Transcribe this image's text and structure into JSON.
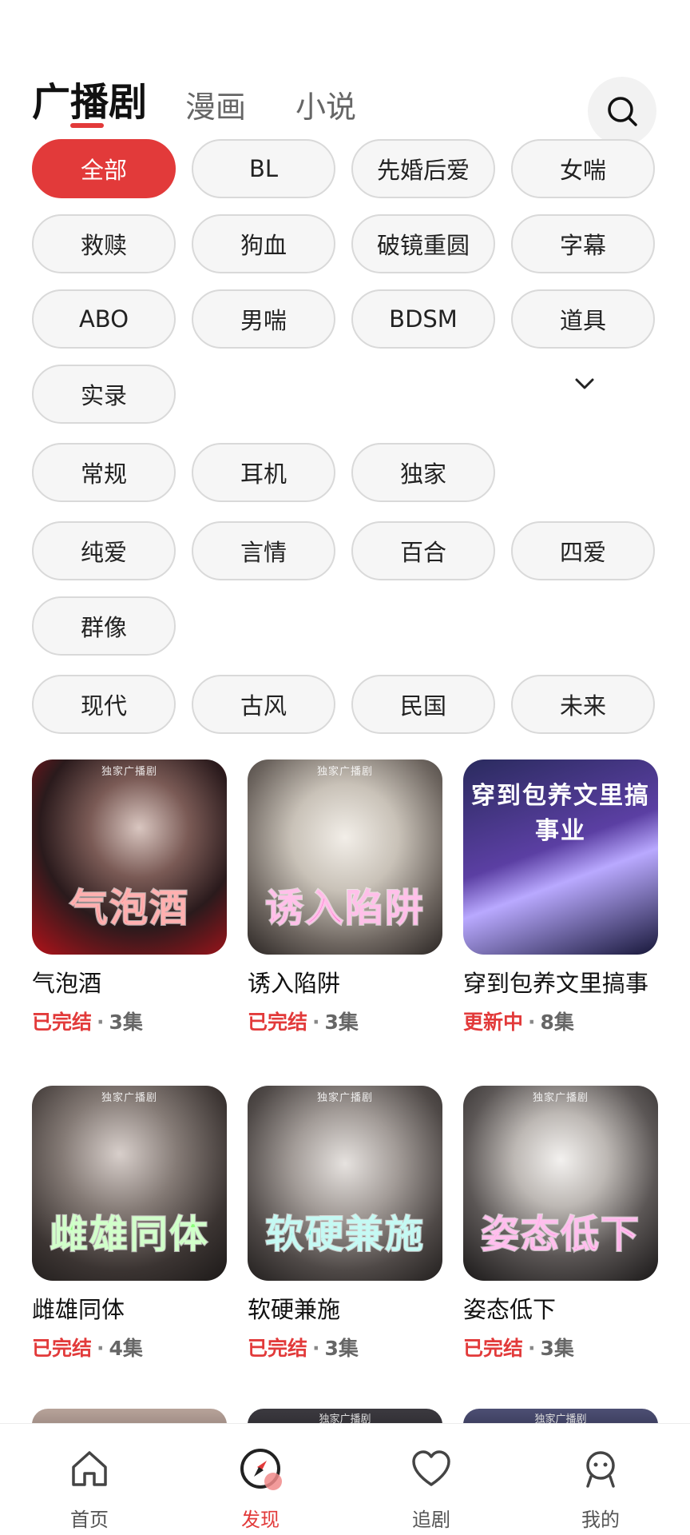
{
  "header": {
    "tabs": [
      {
        "label": "广播剧",
        "active": true
      },
      {
        "label": "漫画",
        "active": false
      },
      {
        "label": "小说",
        "active": false
      }
    ],
    "search_icon": "search-icon"
  },
  "filters": {
    "group1": [
      "全部",
      "BL",
      "先婚后爱",
      "女喘",
      "救赎",
      "狗血",
      "破镜重圆",
      "字幕",
      "ABO",
      "男喘",
      "BDSM",
      "道具",
      "实录"
    ],
    "group2": [
      "常规",
      "耳机",
      "独家"
    ],
    "group3": [
      "纯爱",
      "言情",
      "百合",
      "四爱",
      "群像"
    ],
    "group4": [
      "现代",
      "古风",
      "民国",
      "未来"
    ],
    "expand_icon": "chevron-down-icon",
    "accent": "#e23a3a"
  },
  "cards": [
    {
      "cover_tag": "独家广播剧",
      "cover_text": "气泡酒",
      "title": "气泡酒",
      "status": "已完结",
      "episodes": "3集"
    },
    {
      "cover_tag": "独家广播剧",
      "cover_text": "诱入陷阱",
      "title": "诱入陷阱",
      "status": "已完结",
      "episodes": "3集"
    },
    {
      "cover_tag": "",
      "cover_text": "穿到包养文里搞事业",
      "title": "穿到包养文里搞事",
      "status": "更新中",
      "episodes": "8集"
    },
    {
      "cover_tag": "独家广播剧",
      "cover_text": "雌雄同体",
      "title": "雌雄同体",
      "status": "已完结",
      "episodes": "4集"
    },
    {
      "cover_tag": "独家广播剧",
      "cover_text": "软硬兼施",
      "title": "软硬兼施",
      "status": "已完结",
      "episodes": "3集"
    },
    {
      "cover_tag": "独家广播剧",
      "cover_text": "姿态低下",
      "title": "姿态低下",
      "status": "已完结",
      "episodes": "3集"
    }
  ],
  "peek_tags": [
    "",
    "独家广播剧",
    "独家广播剧"
  ],
  "bottom_nav": [
    {
      "label": "首页",
      "icon": "home-icon",
      "active": false
    },
    {
      "label": "发现",
      "icon": "compass-icon",
      "active": true
    },
    {
      "label": "追剧",
      "icon": "heart-icon",
      "active": false
    },
    {
      "label": "我的",
      "icon": "profile-icon",
      "active": false
    }
  ]
}
